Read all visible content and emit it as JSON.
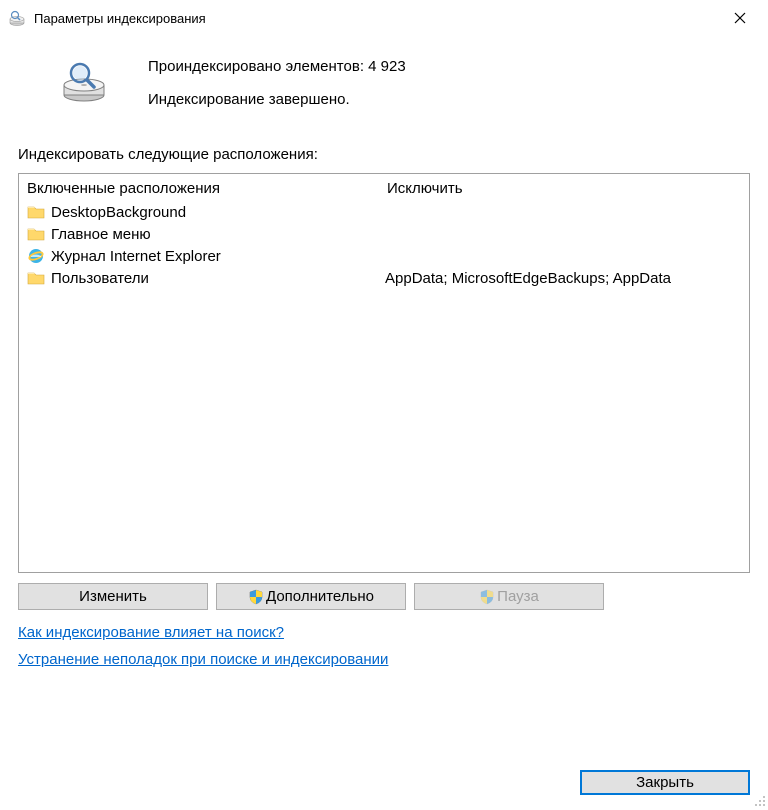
{
  "window": {
    "title": "Параметры индексирования"
  },
  "status": {
    "indexed_count_label": "Проиндексировано элементов: 4 923",
    "completion_label": "Индексирование завершено."
  },
  "locations": {
    "section_label": "Индексировать следующие расположения:",
    "col_included": "Включенные расположения",
    "col_excluded": "Исключить",
    "rows": [
      {
        "icon": "folder",
        "name": "DesktopBackground",
        "excluded": ""
      },
      {
        "icon": "folder",
        "name": "Главное меню",
        "excluded": ""
      },
      {
        "icon": "ie",
        "name": "Журнал Internet Explorer",
        "excluded": ""
      },
      {
        "icon": "folder",
        "name": "Пользователи",
        "excluded": "AppData; MicrosoftEdgeBackups; AppData"
      }
    ]
  },
  "buttons": {
    "modify": "Изменить",
    "advanced": "Дополнительно",
    "pause": "Пауза",
    "close": "Закрыть"
  },
  "links": {
    "how_affects": "Как индексирование влияет на поиск?",
    "troubleshoot": "Устранение неполадок при поиске и индексировании"
  }
}
